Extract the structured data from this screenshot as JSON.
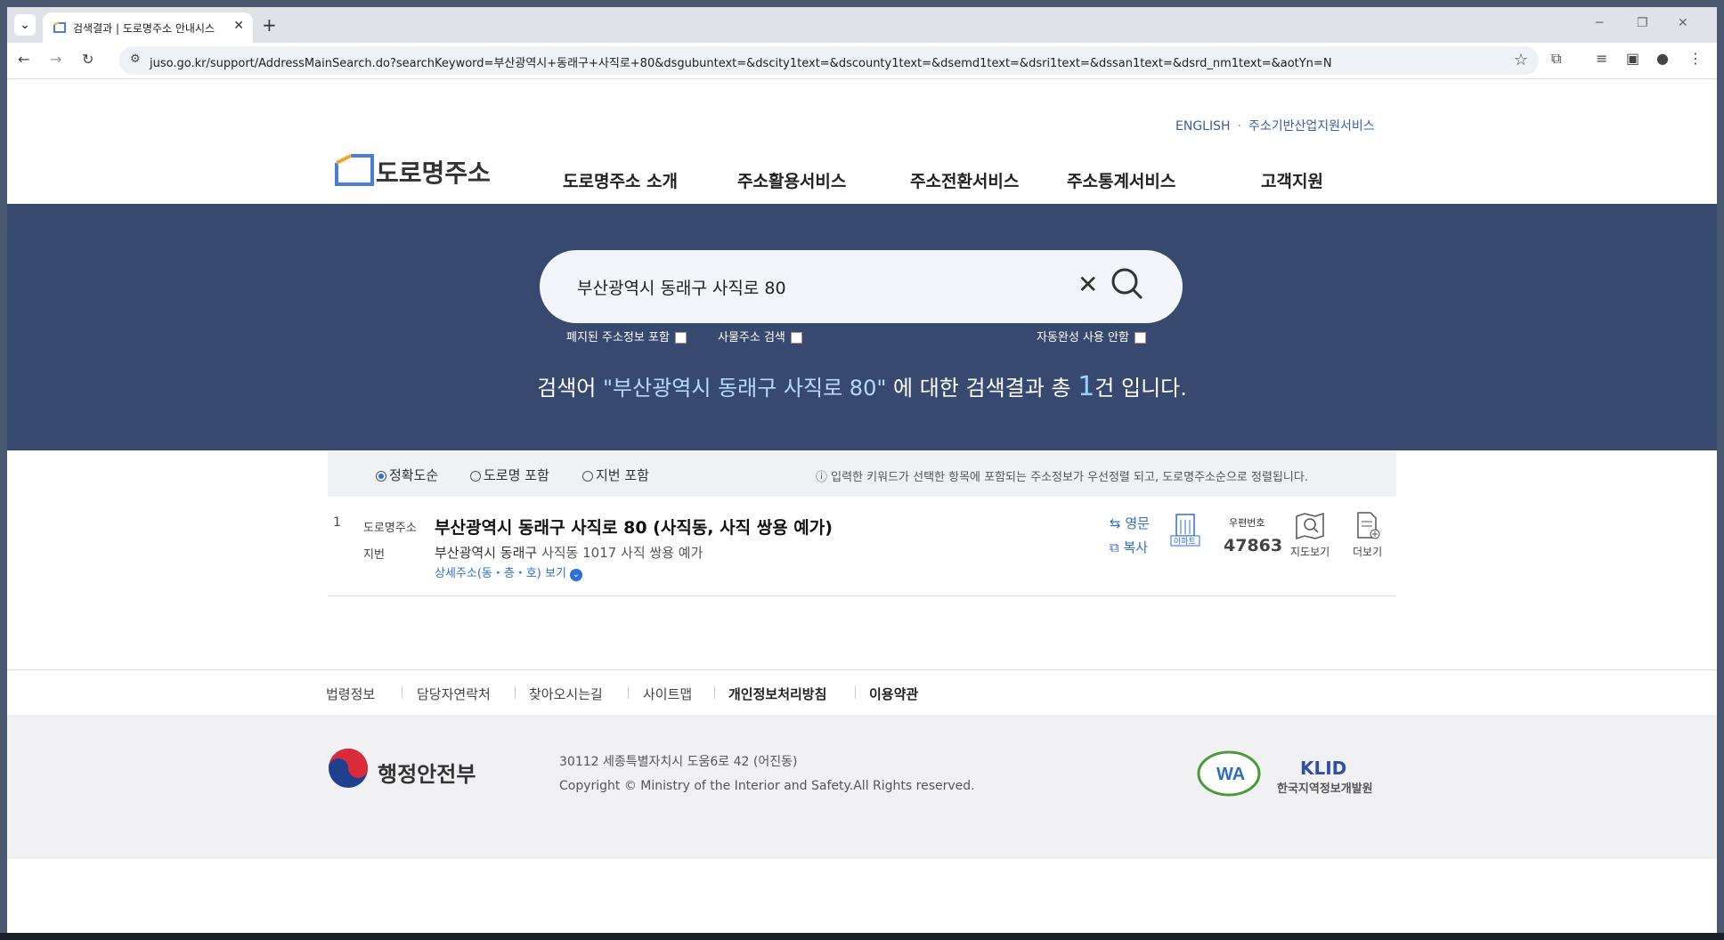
{
  "browser": {
    "tab_title": "검색결과 | 도로명주소 안내시스",
    "url": "juso.go.kr/support/AddressMainSearch.do?searchKeyword=부산광역시+동래구+사직로+80&dsgubuntext=&dscity1text=&dscounty1text=&dsemd1text=&dsri1text=&dssan1text=&dsrd_nm1text=&aotYn=N"
  },
  "header": {
    "util_links": [
      "ENGLISH",
      "주소기반산업지원서비스"
    ],
    "logo_text": "도로명주소",
    "nav": [
      "도로명주소 소개",
      "주소활용서비스",
      "주소전환서비스",
      "주소통계서비스",
      "고객지원"
    ]
  },
  "search": {
    "query": "부산광역시 동래구 사직로 80",
    "options": {
      "include_abolished": "폐지된 주소정보 포함",
      "object_address": "사물주소 검색",
      "no_autocomplete": "자동완성 사용 안함"
    },
    "result_prefix": "검색어 ",
    "result_keyword": "\"부산광역시 동래구 사직로 80\"",
    "result_mid": " 에 대한 검색결과 총 ",
    "result_count": "1",
    "result_suffix": "건 입니다."
  },
  "sort": {
    "options": [
      "정확도순",
      "도로명 포함",
      "지번 포함"
    ],
    "selected": "정확도순",
    "note": "ⓘ 입력한 키워드가 선택한 항목에 포함되는 주소정보가 우선정렬 되고, 도로명주소순으로 정렬됩니다."
  },
  "results": [
    {
      "no": "1",
      "road_label": "도로명주소",
      "road_address": "부산광역시 동래구 사직로 80 (사직동, 사직 쌍용 예가)",
      "jibun_label": "지번",
      "jibun_city": "부산광역시 동래구",
      "jibun_rest": " 사직동 1017 사직 쌍용 예가",
      "detail_link": "상세주소(동・층・호) 보기",
      "english_btn": "영문",
      "copy_btn": "복사",
      "apt_label": "아파트",
      "zip_label": "우편번호",
      "zip": "47863",
      "map_btn": "지도보기",
      "more_btn": "더보기"
    }
  ],
  "footer": {
    "links": [
      "법령정보",
      "담당자연락처",
      "찾아오시는길",
      "사이트맵",
      "개인정보처리방침",
      "이용약관"
    ],
    "ministry": "행정안전부",
    "address": "30112 세종특별자치시 도움6로 42 (어진동)",
    "copyright": "Copyright © Ministry of the Interior and Safety.All Rights reserved.",
    "klid": "KLID",
    "klid_name": "한국지역정보개발원",
    "wa_label": "WA"
  }
}
